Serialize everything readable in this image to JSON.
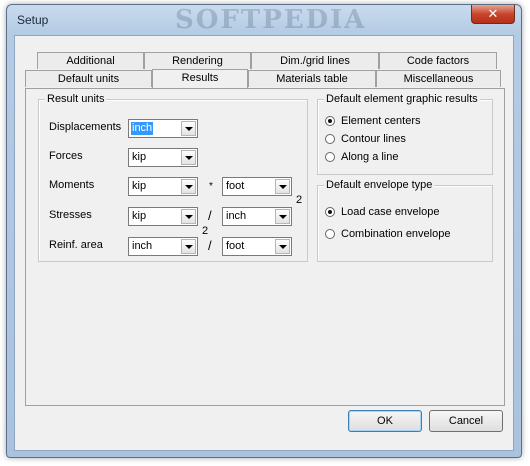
{
  "window": {
    "title": "Setup",
    "close_glyph": "✕",
    "watermark": "SOFTPEDIA"
  },
  "tabs_row1": [
    "Additional",
    "Rendering",
    "Dim./grid lines",
    "Code factors"
  ],
  "tabs_row2": [
    "Default units",
    "Results",
    "Materials table",
    "Miscellaneous"
  ],
  "active_tab": "Results",
  "result_units": {
    "title": "Result units",
    "displacements": {
      "label": "Displacements",
      "value": "inch"
    },
    "forces": {
      "label": "Forces",
      "value": "kip"
    },
    "moments": {
      "label": "Moments",
      "value1": "kip",
      "op": "*",
      "value2": "foot"
    },
    "stresses": {
      "label": "Stresses",
      "value1": "kip",
      "op": "/",
      "value2": "inch",
      "exponent": "2"
    },
    "reinf_area": {
      "label": "Reinf. area",
      "value1": "inch",
      "exponent": "2",
      "op": "/",
      "value2": "foot"
    }
  },
  "element_graphic": {
    "title": "Default element graphic results",
    "options": [
      "Element centers",
      "Contour lines",
      "Along a line"
    ],
    "selected": 0
  },
  "envelope_type": {
    "title": "Default envelope type",
    "options": [
      "Load case envelope",
      "Combination envelope"
    ],
    "selected": 0
  },
  "buttons": {
    "ok": "OK",
    "cancel": "Cancel"
  }
}
